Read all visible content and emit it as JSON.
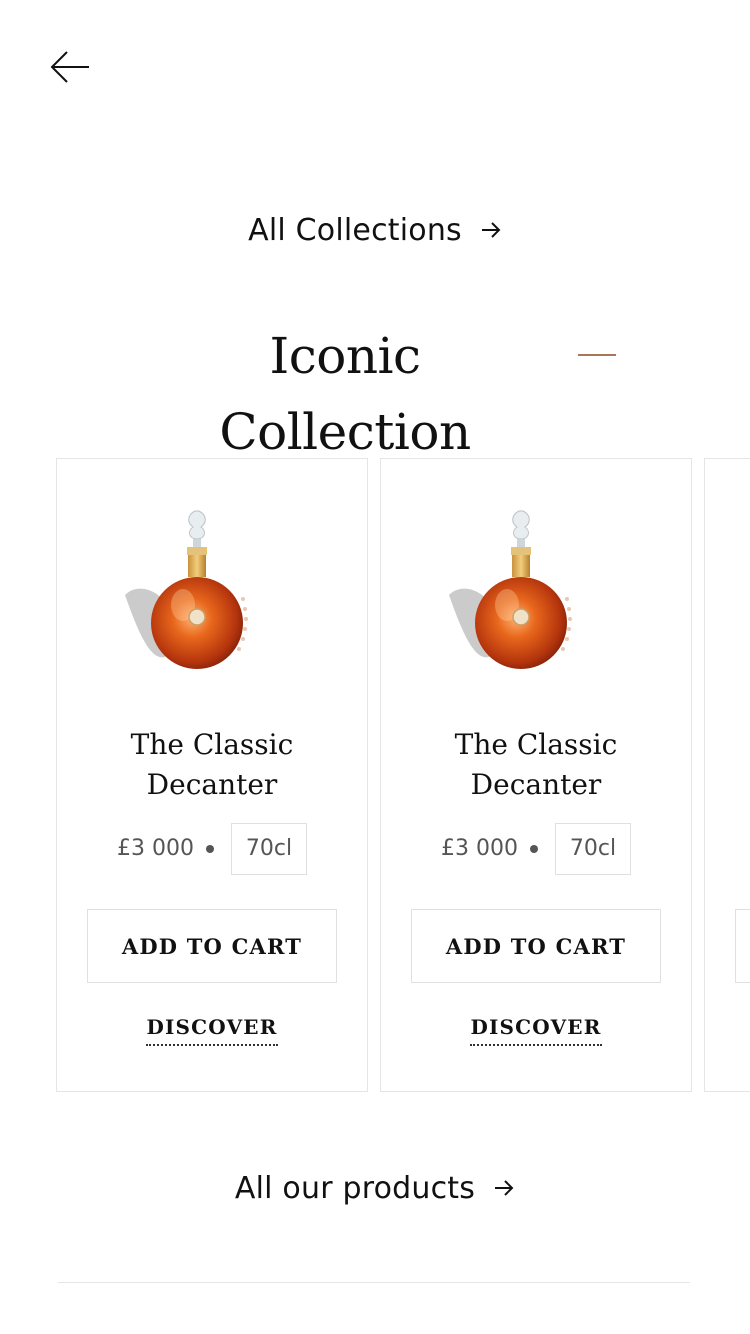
{
  "nav": {
    "back_icon": "arrow-left-icon"
  },
  "links": {
    "all_collections": "All Collections",
    "all_products": "All our products",
    "arrow_icon": "arrow-right-icon"
  },
  "section": {
    "title": "Iconic Collection",
    "accent_color": "#a8775a"
  },
  "products": [
    {
      "name_line1": "The Classic",
      "name_line2": "Decanter",
      "price": "£3 000",
      "volume": "70cl",
      "add_to_cart_label": "ADD TO CART",
      "discover_label": "DISCOVER",
      "image_icon": "cognac-decanter-image"
    },
    {
      "name_line1": "The Classic",
      "name_line2": "Decanter",
      "price": "£3 000",
      "volume": "70cl",
      "add_to_cart_label": "ADD TO CART",
      "discover_label": "DISCOVER",
      "image_icon": "cognac-decanter-image"
    },
    {
      "name_line1": "",
      "name_line2": "",
      "price": "",
      "volume": "",
      "add_to_cart_label": "",
      "discover_label": "",
      "image_icon": ""
    }
  ]
}
